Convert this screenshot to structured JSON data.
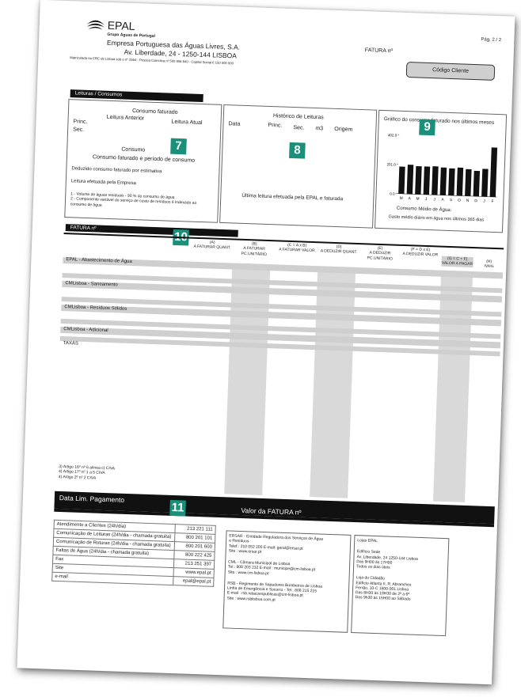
{
  "header": {
    "logo_text": "EPAL",
    "group": "Grupo Águas de Portugal",
    "company": "Empresa Portuguesa das Águas Livres, S.A.",
    "address": "Av. Liberdade, 24 - 1250-144 LISBOA",
    "registry": "Matriculada na CRC de Lisboa sob o nº 2364 - Pessoa Colectiva nº 500 906 840 - Capital Social € 150 000 000",
    "fatura_label": "FATURA nº",
    "page": "Pág. 2 / 2",
    "codigo_cliente": "Código Cliente"
  },
  "readings": {
    "bar_title": "Leituras / Consumos",
    "consumo_faturado": "Consumo faturado",
    "leitura_anterior": "Leitura Anterior",
    "leitura_atual": "Leitura Atual",
    "princ": "Princ.",
    "sec": "Sec.",
    "consumo": "Consumo",
    "consumo_periodo": "Consumo faturado e período de consumo",
    "deduzido": "Deduzido consumo faturado por estimativa",
    "leitura_empresa": "Leitura efetuada pela Empresa",
    "note1": "1 - Volume de águas residuais - 90 % do consumo de água",
    "note2": "2 - Componente variável do serviço de custo de resíduos é indexado ao consumo de água",
    "badge": "7"
  },
  "history": {
    "title": "Histórico de Leituras",
    "data": "Data",
    "princ": "Princ.",
    "sec": "Sec.",
    "m3": "m3",
    "origem": "Origem",
    "ultima": "Última leitura efetuada pela EPAL e faturada",
    "badge": "8"
  },
  "chart_box": {
    "title": "Gráfico do consumo faturado nos últimos meses",
    "consumo_medio": "Consumo Médio de Água:",
    "gasto_medio": "Gasto médio diário em água nos últimos 365 dias",
    "badge": "9"
  },
  "chart_data": {
    "type": "bar",
    "categories": [
      "M",
      "A",
      "M",
      "J",
      "J",
      "A",
      "S",
      "O",
      "N",
      "D",
      "J",
      "F"
    ],
    "values": [
      186,
      201,
      193,
      193,
      196,
      190,
      186,
      193,
      184,
      175,
      190,
      339
    ],
    "ylim": [
      0,
      402
    ],
    "yticks": [
      "0.0",
      "201.0",
      "402.0"
    ]
  },
  "invoice": {
    "bar_title": "FATURA nº",
    "badge": "10",
    "columns": [
      {
        "letter": "(A)",
        "label": "A FATURAR QUANT."
      },
      {
        "letter": "(B)",
        "label": "A FATURAR PC.UNITÁRIO"
      },
      {
        "letter": "(C = A x B)",
        "label": "A FATURAR VALOR"
      },
      {
        "letter": "(D)",
        "label": "A DEDUZIR QUANT."
      },
      {
        "letter": "(E)",
        "label": "A DEDUZIR PC.UNITÁRIO"
      },
      {
        "letter": "(F = D x E)",
        "label": "A DEDUZIR VALOR"
      },
      {
        "letter": "(G = C + F)",
        "label": "VALOR A PAGAR"
      },
      {
        "letter": "(H)",
        "label": "IVA%"
      }
    ],
    "sections": [
      "EPAL - Abastecimento de Água",
      "CMLisboa - Saneamento",
      "CMLisboa - Resíduos Sólidos",
      "CMLisboa - Adicional",
      "TAXAS"
    ],
    "footnotes": [
      "3) Artigo 16º nº 6 alínea c) CIVA",
      "4) Artigo 17º nº 1 a 5 CIVA",
      "4) Artigo 2º nº 2 CIVA"
    ]
  },
  "payment": {
    "data_lim": "Data Lim. Pagamento",
    "valor": "Valor da FATURA nº",
    "badge": "11"
  },
  "contacts": [
    {
      "label": "Atendimento a Clientes (24h/dia)",
      "value": "213 221 111"
    },
    {
      "label": "Comunicação de Leituras (24h/dia - chamada gratuita)",
      "value": "800 201 101"
    },
    {
      "label": "Comunicação de Roturas (24h/dia - chamada gratuita)",
      "value": "800 201 600"
    },
    {
      "label": "Faltas de Água (24h/dia - chamada gratuita)",
      "value": "800 222 425"
    },
    {
      "label": "Fax",
      "value": "213 251 397"
    },
    {
      "label": "Site",
      "value": "www.epal.pt"
    },
    {
      "label": "e-mail",
      "value": "epal@epal.pt"
    }
  ],
  "entities": {
    "ersar1": "ERSAR - Entidade Reguladora dos Serviços de Água",
    "ersar2": "e Resíduos",
    "ersar3": "Telef.: 210 052 200  E-mail: geral@ersar.pt",
    "ersar4": "Site : www.ersar.pt",
    "cml1": "CML - Câmara Municipal de Lisboa",
    "cml2": "Tel.: 808 203 232  E-mail : municipe@cm-lisboa.pt",
    "cml3": "Site : www.cm-lisboa.pt",
    "rsb1": "RSB - Regimento de Sapadores Bombeiros de Lisboa",
    "rsb2": "Linha de Emergência e Socorro - Tel.: 808 215 215",
    "rsb3": "E-mail : rsb.relacoespublicas@cm-lisboa.pt",
    "rsb4": "Site : www.rsblisboa.com.pt"
  },
  "lojas": {
    "title": "Lojas EPAL",
    "l1": "Edifício Sede",
    "l2": "Av. Liberdade, 24 1250-144 Lisboa",
    "l3": "Das 9H00 às 17H00",
    "l4": "Todos os dias úteis",
    "l5": "Loja do Cidadão",
    "l6": "Edifício Atlanta II, R. Abranches",
    "l7": "Ferrão, 10-C 1600-001 Lisboa",
    "l8": "Das 8H30 às 19H30 de 2ª a 6ª",
    "l9": "Das 9h30 às 15H00 ao Sábado"
  },
  "colors": {
    "badge": "#1a8f7a",
    "bar": "#111111",
    "gray": "#d9d9d9"
  }
}
